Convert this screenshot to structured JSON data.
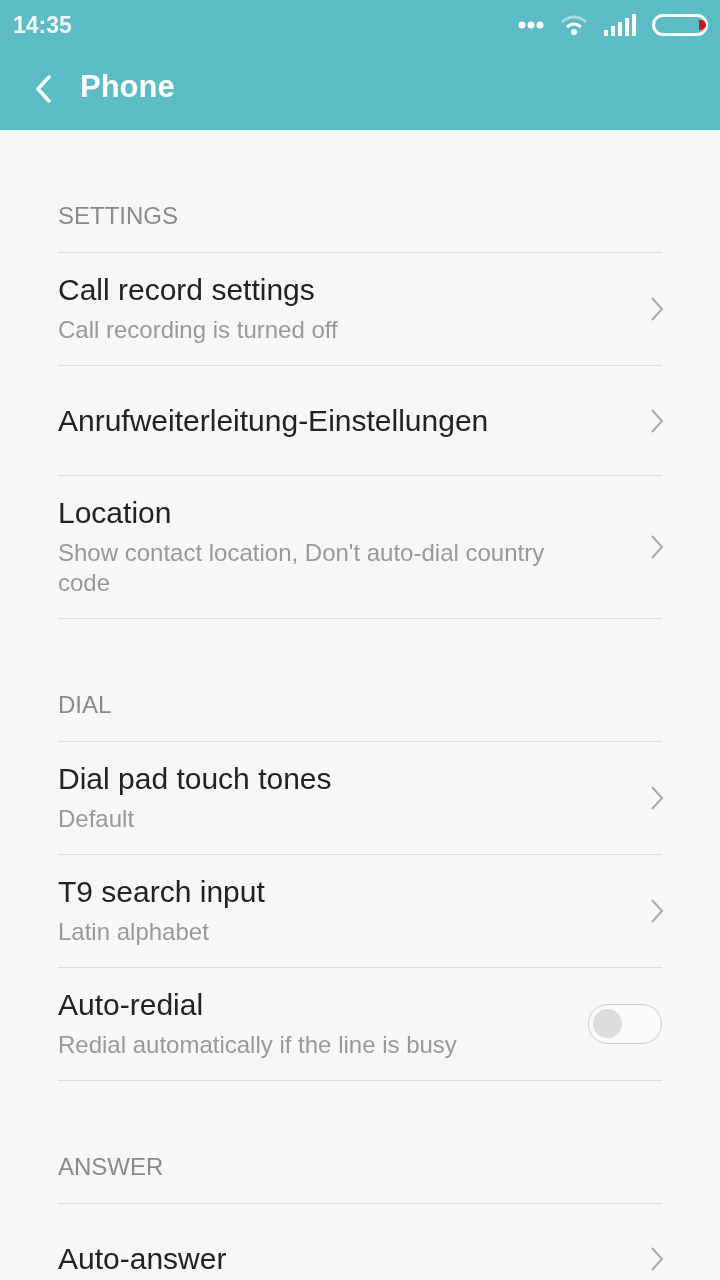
{
  "status_bar": {
    "time": "14:35"
  },
  "title_bar": {
    "title": "Phone"
  },
  "sections": [
    {
      "label": "SETTINGS",
      "items": [
        {
          "kind": "link",
          "title": "Call record settings",
          "subtitle": "Call recording is turned off"
        },
        {
          "kind": "link",
          "title": "Anrufweiterleitung-Einstellungen"
        },
        {
          "kind": "link",
          "title": "Location",
          "subtitle": "Show contact location, Don't auto-dial country code"
        }
      ]
    },
    {
      "label": "DIAL",
      "items": [
        {
          "kind": "link",
          "title": "Dial pad touch tones",
          "subtitle": "Default"
        },
        {
          "kind": "link",
          "title": "T9 search input",
          "subtitle": "Latin alphabet"
        },
        {
          "kind": "toggle",
          "title": "Auto-redial",
          "subtitle": "Redial automatically if the line is busy",
          "on": false
        }
      ]
    },
    {
      "label": "ANSWER",
      "items": [
        {
          "kind": "link",
          "title": "Auto-answer"
        }
      ]
    }
  ]
}
